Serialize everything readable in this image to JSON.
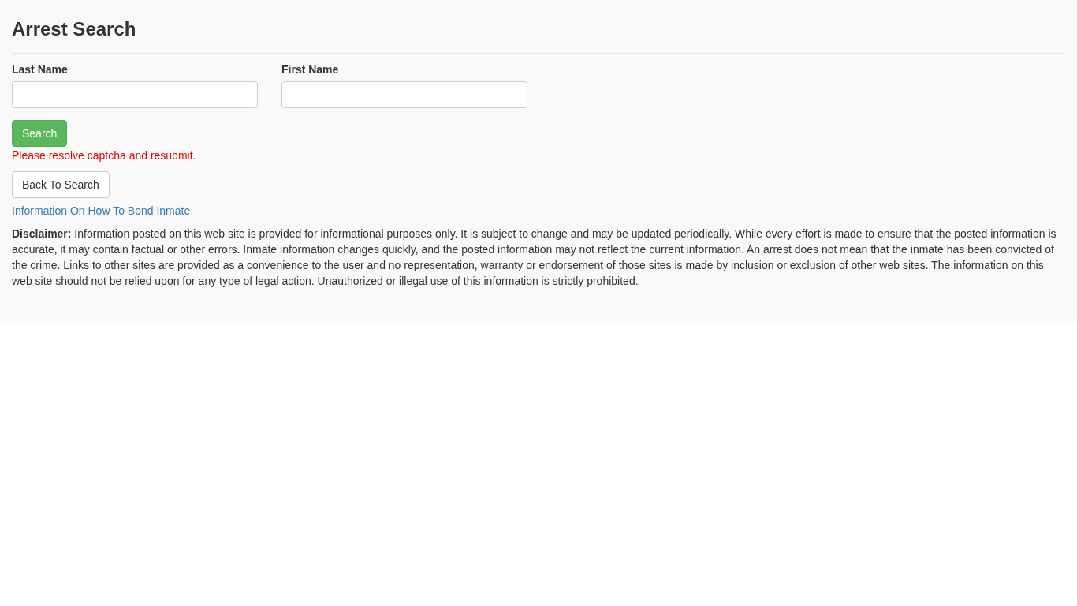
{
  "title": "Arrest Search",
  "fields": [
    {
      "label": "Last Name"
    },
    {
      "label": "First Name"
    }
  ],
  "search_button": "Search",
  "error": "Please resolve captcha and resubmit.",
  "back_button": "Back To Search",
  "bond_link": "Information On How To Bond Inmate",
  "disclaimer": "**Disclaimer:** Information posted on this web site is provided for informational purposes only. It is subject to change and may be updated periodically. While every effort is made to ensure that the posted information is accurate, it may contain factual or other errors. Inmate information changes quickly, and the posted information may not reflect the current information. An arrest does not mean that the inmate has been convicted of the crime. Links to other sites are provided as a convenience to the user and no representation, warranty or endorsement of those sites is made by inclusion or exclusion of other web sites. The information on this web site should not be relied upon for any type of legal action. Unauthorized or illegal use of this information is strictly prohibited."
}
